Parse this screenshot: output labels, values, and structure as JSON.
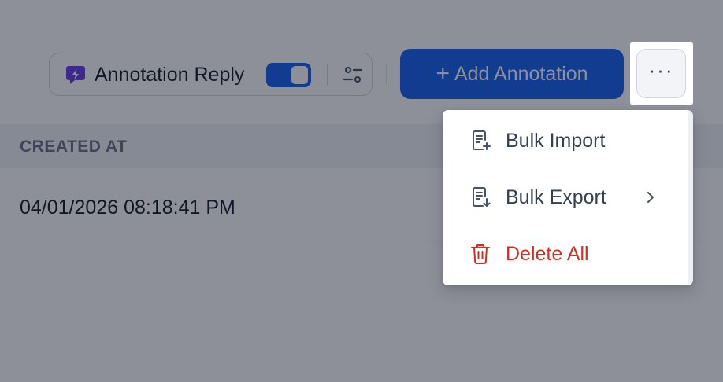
{
  "toolbar": {
    "annotation_reply_label": "Annotation Reply",
    "annotation_reply_enabled": true,
    "add_annotation_label": "Add Annotation",
    "add_annotation_prefix": "+",
    "more_label": "···"
  },
  "table": {
    "columns": [
      "CREATED AT"
    ],
    "rows": [
      {
        "created_at": "04/01/2026 08:18:41 PM"
      }
    ]
  },
  "menu": {
    "items": [
      {
        "label": "Bulk Import",
        "icon": "file-plus-icon"
      },
      {
        "label": "Bulk Export",
        "icon": "file-download-icon",
        "submenu": true
      },
      {
        "label": "Delete All",
        "icon": "trash-icon",
        "danger": true
      }
    ]
  },
  "colors": {
    "primary": "#155eef",
    "danger": "#d92d20",
    "reply_icon": "#6938ef",
    "text": "#101828",
    "muted_text": "#344054"
  }
}
